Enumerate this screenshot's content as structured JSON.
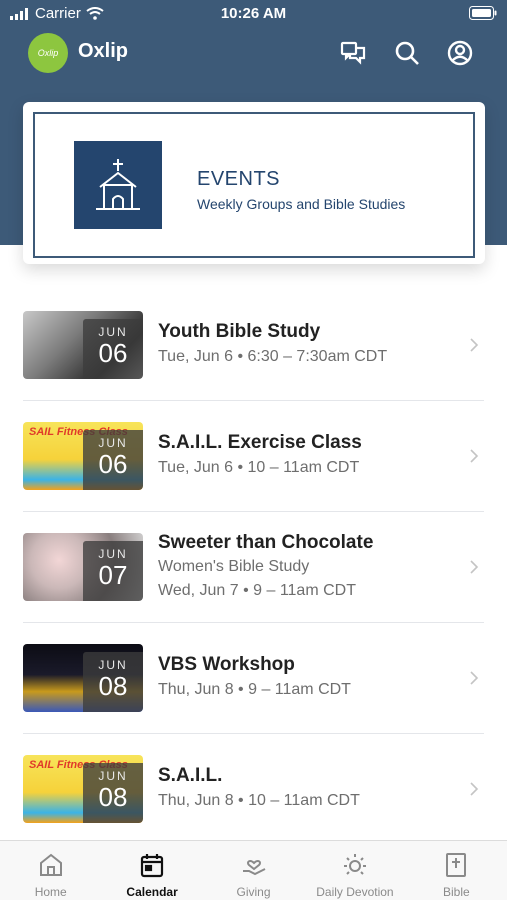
{
  "status_bar": {
    "carrier": "Carrier",
    "time": "10:26 AM"
  },
  "app": {
    "logo_text": "Oxlip",
    "title": "Oxlip"
  },
  "events_card": {
    "title": "EVENTS",
    "subtitle": "Weekly Groups and Bible Studies"
  },
  "events": [
    {
      "month": "JUN",
      "day": "06",
      "title": "Youth Bible Study",
      "line1": "Tue, Jun 6 • 6:30 – 7:30am CDT",
      "line2": "",
      "thumb": "dark-photo"
    },
    {
      "month": "JUN",
      "day": "06",
      "title": "S.A.I.L. Exercise Class",
      "line1": "Tue, Jun 6 • 10 – 11am CDT",
      "line2": "",
      "thumb": "sail-poster",
      "thumb_text": "SAIL Fitness Class"
    },
    {
      "month": "JUN",
      "day": "07",
      "title": "Sweeter than Chocolate",
      "line1": "Women's Bible Study",
      "line2": "Wed, Jun 7 • 9 – 11am CDT",
      "thumb": "blossom-photo"
    },
    {
      "month": "JUN",
      "day": "08",
      "title": "VBS Workshop",
      "line1": "Thu, Jun 8 • 9 – 11am CDT",
      "line2": "",
      "thumb": "castle-art"
    },
    {
      "month": "JUN",
      "day": "08",
      "title": "S.A.I.L.",
      "line1": "Thu, Jun 8 • 10 – 11am CDT",
      "line2": "",
      "thumb": "sail-poster",
      "thumb_text": "SAIL Fitness Class"
    }
  ],
  "tabs": [
    {
      "label": "Home",
      "icon": "home-icon",
      "active": false
    },
    {
      "label": "Calendar",
      "icon": "calendar-icon",
      "active": true
    },
    {
      "label": "Giving",
      "icon": "giving-icon",
      "active": false
    },
    {
      "label": "Daily Devotion",
      "icon": "sun-icon",
      "active": false
    },
    {
      "label": "Bible",
      "icon": "bible-icon",
      "active": false
    }
  ],
  "colors": {
    "header": "#3d5a78",
    "card_accent": "#24456e",
    "logo": "#8dc63f"
  }
}
